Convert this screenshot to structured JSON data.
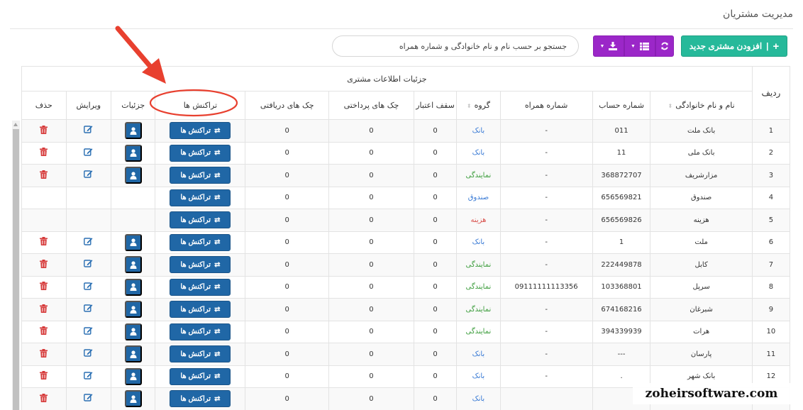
{
  "page": {
    "title": "مدیریت مشتریان"
  },
  "toolbar": {
    "add_label": "افزودن مشتری جدید",
    "add_prefix": "| ",
    "search_placeholder": "جستجو بر حسب نام و نام خانوادگی و شماره همراه"
  },
  "table": {
    "group_header": "جزئیات اطلاعات مشتری",
    "headers": {
      "rowno": "ردیف",
      "name": "نام و نام خانوادگی",
      "account": "شماره حساب",
      "mobile": "شماره همراه",
      "group": "گروه",
      "credit": "سقف اعتبار",
      "paid_checks": "چک های پرداختی",
      "received_checks": "چک های دریافتی",
      "transactions": "تراکنش ها",
      "details": "جزئیات",
      "edit": "ویرایش",
      "delete": "حذف"
    },
    "tx_button_label": "تراکنش ها",
    "rows": [
      {
        "no": "1",
        "name": "بانک ملت",
        "account": "011",
        "mobile": "-",
        "group": "بانک",
        "group_type": "bank",
        "credit": "0",
        "paid": "0",
        "received": "0",
        "actions": true
      },
      {
        "no": "2",
        "name": "بانک ملی",
        "account": "11",
        "mobile": "-",
        "group": "بانک",
        "group_type": "bank",
        "credit": "0",
        "paid": "0",
        "received": "0",
        "actions": true
      },
      {
        "no": "3",
        "name": "مزارشریف",
        "account": "368872707",
        "mobile": "-",
        "group": "نمایندگی",
        "group_type": "rep",
        "credit": "0",
        "paid": "0",
        "received": "0",
        "actions": true
      },
      {
        "no": "4",
        "name": "صندوق",
        "account": "656569821",
        "mobile": "-",
        "group": "صندوق",
        "group_type": "box",
        "credit": "0",
        "paid": "0",
        "received": "0",
        "actions": false
      },
      {
        "no": "5",
        "name": "هزینه",
        "account": "656569826",
        "mobile": "-",
        "group": "هزینه",
        "group_type": "cost",
        "credit": "0",
        "paid": "0",
        "received": "0",
        "actions": false
      },
      {
        "no": "6",
        "name": "ملت",
        "account": "1",
        "mobile": "-",
        "group": "بانک",
        "group_type": "bank",
        "credit": "0",
        "paid": "0",
        "received": "0",
        "actions": true
      },
      {
        "no": "7",
        "name": "کابل",
        "account": "222449878",
        "mobile": "-",
        "group": "نمایندگی",
        "group_type": "rep",
        "credit": "0",
        "paid": "0",
        "received": "0",
        "actions": true
      },
      {
        "no": "8",
        "name": "سرپل",
        "account": "103368801",
        "mobile": "09111111113356",
        "group": "نمایندگی",
        "group_type": "rep",
        "credit": "0",
        "paid": "0",
        "received": "0",
        "actions": true
      },
      {
        "no": "9",
        "name": "شبرغان",
        "account": "674168216",
        "mobile": "-",
        "group": "نمایندگی",
        "group_type": "rep",
        "credit": "0",
        "paid": "0",
        "received": "0",
        "actions": true
      },
      {
        "no": "10",
        "name": "هرات",
        "account": "394339939",
        "mobile": "-",
        "group": "نمایندگی",
        "group_type": "rep",
        "credit": "0",
        "paid": "0",
        "received": "0",
        "actions": true
      },
      {
        "no": "11",
        "name": "پارسان",
        "account": "---",
        "mobile": "-",
        "group": "بانک",
        "group_type": "bank",
        "credit": "0",
        "paid": "0",
        "received": "0",
        "actions": true
      },
      {
        "no": "12",
        "name": "بانک شهر",
        "account": ".",
        "mobile": "-",
        "group": "بانک",
        "group_type": "bank",
        "credit": "0",
        "paid": "0",
        "received": "0",
        "actions": true
      },
      {
        "no": "",
        "name": "",
        "account": "",
        "mobile": "",
        "group": "بانک",
        "group_type": "bank",
        "credit": "0",
        "paid": "0",
        "received": "0",
        "actions": true
      }
    ]
  },
  "watermark": {
    "text": "zoheirsoftware.com"
  },
  "colors": {
    "add_button": "#26b99a",
    "purple_button": "#9b27c8",
    "action_button": "#2067a6",
    "annotation_red": "#e8402f",
    "delete_icon": "#d63a3a"
  },
  "icons": {
    "add": "plus-icon",
    "refresh": "refresh-icon",
    "columns": "list-icon",
    "export": "download-icon",
    "transactions": "exchange-icon",
    "details": "user-icon",
    "edit": "edit-icon",
    "delete": "trash-icon"
  }
}
